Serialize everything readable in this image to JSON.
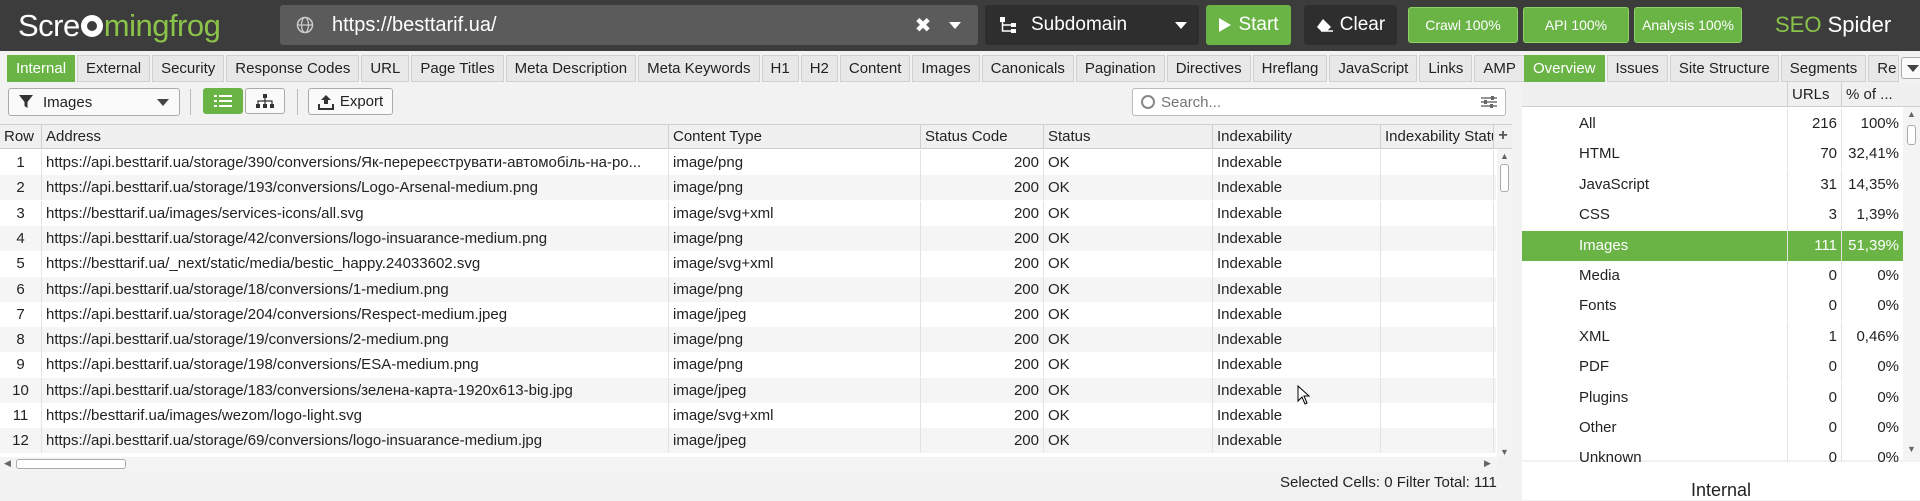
{
  "app": {
    "logo_left": "Scre",
    "logo_mid": "mingfrog",
    "brand_seo": "SEO",
    "brand_rest": " Spider"
  },
  "toolbar": {
    "url": "https://besttarif.ua/",
    "mode": "Subdomain",
    "start": "Start",
    "clear": "Clear",
    "crawl": "Crawl 100%",
    "api": "API 100%",
    "analysis": "Analysis 100%"
  },
  "tabs": [
    "Internal",
    "External",
    "Security",
    "Response Codes",
    "URL",
    "Page Titles",
    "Meta Description",
    "Meta Keywords",
    "H1",
    "H2",
    "Content",
    "Images",
    "Canonicals",
    "Pagination",
    "Directives",
    "Hreflang",
    "JavaScript",
    "Links",
    "AMP"
  ],
  "right_tabs": [
    "Overview",
    "Issues",
    "Site Structure",
    "Segments",
    "Re"
  ],
  "filter": {
    "selected": "Images",
    "export": "Export",
    "search_placeholder": "Search..."
  },
  "grid": {
    "columns": [
      "Row",
      "Address",
      "Content Type",
      "Status Code",
      "Status",
      "Indexability",
      "Indexability Statu"
    ],
    "rows": [
      [
        "1",
        "https://api.besttarif.ua/storage/390/conversions/Як-перереєструвати-автомобіль-на-ро...",
        "image/png",
        "200",
        "OK",
        "Indexable",
        ""
      ],
      [
        "2",
        "https://api.besttarif.ua/storage/193/conversions/Logo-Arsenal-medium.png",
        "image/png",
        "200",
        "OK",
        "Indexable",
        ""
      ],
      [
        "3",
        "https://besttarif.ua/images/services-icons/all.svg",
        "image/svg+xml",
        "200",
        "OK",
        "Indexable",
        ""
      ],
      [
        "4",
        "https://api.besttarif.ua/storage/42/conversions/logo-insuarance-medium.png",
        "image/png",
        "200",
        "OK",
        "Indexable",
        ""
      ],
      [
        "5",
        "https://besttarif.ua/_next/static/media/bestic_happy.24033602.svg",
        "image/svg+xml",
        "200",
        "OK",
        "Indexable",
        ""
      ],
      [
        "6",
        "https://api.besttarif.ua/storage/18/conversions/1-medium.png",
        "image/png",
        "200",
        "OK",
        "Indexable",
        ""
      ],
      [
        "7",
        "https://api.besttarif.ua/storage/204/conversions/Respect-medium.jpeg",
        "image/jpeg",
        "200",
        "OK",
        "Indexable",
        ""
      ],
      [
        "8",
        "https://api.besttarif.ua/storage/19/conversions/2-medium.png",
        "image/png",
        "200",
        "OK",
        "Indexable",
        ""
      ],
      [
        "9",
        "https://api.besttarif.ua/storage/198/conversions/ESA-medium.png",
        "image/png",
        "200",
        "OK",
        "Indexable",
        ""
      ],
      [
        "10",
        "https://api.besttarif.ua/storage/183/conversions/зелена-карта-1920x613-big.jpg",
        "image/jpeg",
        "200",
        "OK",
        "Indexable",
        ""
      ],
      [
        "11",
        "https://besttarif.ua/images/wezom/logo-light.svg",
        "image/svg+xml",
        "200",
        "OK",
        "Indexable",
        ""
      ],
      [
        "12",
        "https://api.besttarif.ua/storage/69/conversions/logo-insuarance-medium.jpg",
        "image/jpeg",
        "200",
        "OK",
        "Indexable",
        ""
      ]
    ]
  },
  "status_bar": {
    "selected_label": "Selected Cells:",
    "selected_value": "0",
    "filter_label": "Filter Total:",
    "filter_value": "111"
  },
  "overview": {
    "col_urls": "URLs",
    "col_pct": "% of ...",
    "rows": [
      {
        "name": "All",
        "urls": "216",
        "pct": "100%"
      },
      {
        "name": "HTML",
        "urls": "70",
        "pct": "32,41%"
      },
      {
        "name": "JavaScript",
        "urls": "31",
        "pct": "14,35%"
      },
      {
        "name": "CSS",
        "urls": "3",
        "pct": "1,39%"
      },
      {
        "name": "Images",
        "urls": "111",
        "pct": "51,39%"
      },
      {
        "name": "Media",
        "urls": "0",
        "pct": "0%"
      },
      {
        "name": "Fonts",
        "urls": "0",
        "pct": "0%"
      },
      {
        "name": "XML",
        "urls": "1",
        "pct": "0,46%"
      },
      {
        "name": "PDF",
        "urls": "0",
        "pct": "0%"
      },
      {
        "name": "Plugins",
        "urls": "0",
        "pct": "0%"
      },
      {
        "name": "Other",
        "urls": "0",
        "pct": "0%"
      },
      {
        "name": "Unknown",
        "urls": "0",
        "pct": "0%"
      }
    ],
    "selected_index": 4,
    "footer_title": "Internal"
  },
  "colors": {
    "accent_green": "#6ab446",
    "topbar": "#3c3c3c",
    "url_box": "#5b5b5b"
  }
}
